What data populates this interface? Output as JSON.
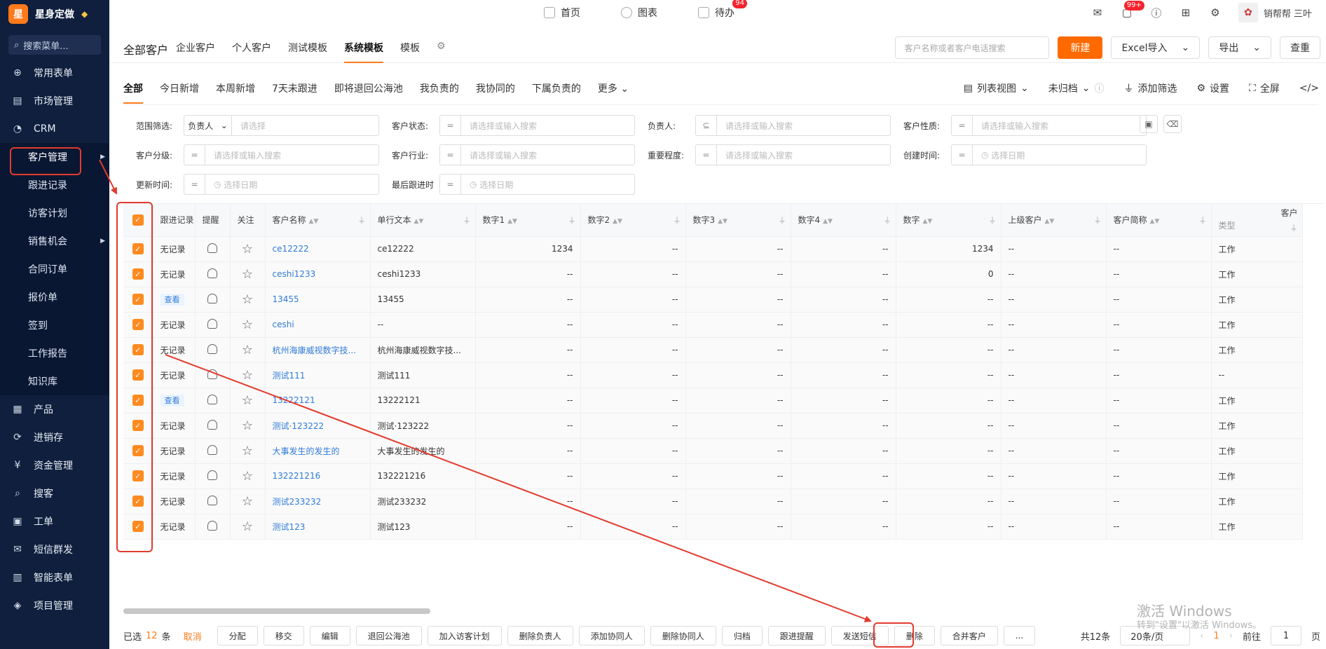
{
  "brand": {
    "logo": "星",
    "name": "星身定做"
  },
  "sidebar": {
    "search_placeholder": "搜索菜单...",
    "items": [
      {
        "label": "常用表单",
        "icon": "plus-circle-icon"
      },
      {
        "label": "市场管理",
        "icon": "clipboard-icon"
      },
      {
        "label": "CRM",
        "icon": "pie-icon"
      }
    ],
    "crm_sub": [
      {
        "label": "客户管理",
        "active": true,
        "caret": true
      },
      {
        "label": "跟进记录"
      },
      {
        "label": "访客计划"
      },
      {
        "label": "销售机会",
        "caret": true
      },
      {
        "label": "合同订单"
      },
      {
        "label": "报价单"
      },
      {
        "label": "签到"
      },
      {
        "label": "工作报告"
      },
      {
        "label": "知识库"
      }
    ],
    "items_after": [
      {
        "label": "产品",
        "icon": "blocks-icon"
      },
      {
        "label": "进销存",
        "icon": "cycle-icon"
      },
      {
        "label": "资金管理",
        "icon": "money-icon"
      },
      {
        "label": "搜客",
        "icon": "search-icon"
      },
      {
        "label": "工单",
        "icon": "ticket-icon"
      },
      {
        "label": "短信群发",
        "icon": "mail-icon"
      },
      {
        "label": "智能表单",
        "icon": "form-icon"
      },
      {
        "label": "项目管理",
        "icon": "layers-icon"
      }
    ]
  },
  "topnav": {
    "items": [
      {
        "label": "首页",
        "icon": "home-icon"
      },
      {
        "label": "图表",
        "icon": "chart-icon"
      },
      {
        "label": "待办",
        "icon": "calendar-icon",
        "badge": "94"
      }
    ],
    "msg_badge": "99+",
    "user": "销帮帮 三叶"
  },
  "page": {
    "title": "全部客户",
    "tabs": [
      "企业客户",
      "个人客户",
      "测试模板",
      "系统模板",
      "模板"
    ],
    "active_tab": "系统模板",
    "search_placeholder": "客户名称或者客户电话搜索",
    "new_label": "新建",
    "excel_label": "Excel导入",
    "export_label": "导出",
    "dedupe_label": "查重"
  },
  "filter_tabs": {
    "items": [
      "全部",
      "今日新增",
      "本周新增",
      "7天未跟进",
      "即将退回公海池",
      "我负责的",
      "我协同的",
      "下属负责的",
      "更多"
    ],
    "active": "全部",
    "view": "列表视图",
    "archive": "未归档",
    "add_filter": "添加筛选",
    "settings": "设置",
    "fullscreen": "全屏"
  },
  "filters": {
    "rows": [
      [
        {
          "label": "范围筛选:",
          "op": "负责人",
          "placeholder": "请选择"
        },
        {
          "label": "客户状态:",
          "op": "=",
          "placeholder": "请选择或输入搜索"
        },
        {
          "label": "负责人:",
          "op": "⊆",
          "placeholder": "请选择或输入搜索"
        },
        {
          "label": "客户性质:",
          "op": "=",
          "placeholder": "请选择或输入搜索"
        }
      ],
      [
        {
          "label": "客户分级:",
          "op": "=",
          "placeholder": "请选择或输入搜索"
        },
        {
          "label": "客户行业:",
          "op": "=",
          "placeholder": "请选择或输入搜索"
        },
        {
          "label": "重要程度:",
          "op": "=",
          "placeholder": "请选择或输入搜索"
        },
        {
          "label": "创建时间:",
          "op": "=",
          "placeholder": "选择日期",
          "date": true
        }
      ],
      [
        {
          "label": "更新时间:",
          "op": "=",
          "placeholder": "选择日期",
          "date": true
        },
        {
          "label": "最后跟进时",
          "op": "=",
          "placeholder": "选择日期",
          "date": true
        }
      ]
    ]
  },
  "table": {
    "columns": [
      "跟进记录",
      "提醒",
      "关注",
      "客户名称",
      "单行文本",
      "数字1",
      "数字2",
      "数字3",
      "数字4",
      "数字",
      "上级客户",
      "客户简称",
      "客户"
    ],
    "last_sub": "类型",
    "rows": [
      {
        "follow": "无记录",
        "name": "ce12222",
        "text": "ce12222",
        "n1": "1234",
        "n2": "--",
        "n3": "--",
        "n4": "--",
        "n": "1234",
        "parent": "--",
        "short": "--",
        "type": "工作"
      },
      {
        "follow": "无记录",
        "name": "ceshi1233",
        "text": "ceshi1233",
        "n1": "--",
        "n2": "--",
        "n3": "--",
        "n4": "--",
        "n": "0",
        "parent": "--",
        "short": "--",
        "type": "工作"
      },
      {
        "follow": "查看",
        "name": "13455",
        "text": "13455",
        "n1": "--",
        "n2": "--",
        "n3": "--",
        "n4": "--",
        "n": "--",
        "parent": "--",
        "short": "--",
        "type": "工作"
      },
      {
        "follow": "无记录",
        "name": "ceshi",
        "text": "--",
        "n1": "--",
        "n2": "--",
        "n3": "--",
        "n4": "--",
        "n": "--",
        "parent": "--",
        "short": "--",
        "type": "工作"
      },
      {
        "follow": "无记录",
        "name": "杭州海康威视数字技...",
        "text": "杭州海康威视数字技...",
        "n1": "--",
        "n2": "--",
        "n3": "--",
        "n4": "--",
        "n": "--",
        "parent": "--",
        "short": "--",
        "type": "工作"
      },
      {
        "follow": "无记录",
        "name": "测试111",
        "text": "测试111",
        "n1": "--",
        "n2": "--",
        "n3": "--",
        "n4": "--",
        "n": "--",
        "parent": "--",
        "short": "--",
        "type": "--"
      },
      {
        "follow": "查看",
        "name": "13222121",
        "text": "13222121",
        "n1": "--",
        "n2": "--",
        "n3": "--",
        "n4": "--",
        "n": "--",
        "parent": "--",
        "short": "--",
        "type": "工作"
      },
      {
        "follow": "无记录",
        "name": "测试·123222",
        "text": "测试·123222",
        "n1": "--",
        "n2": "--",
        "n3": "--",
        "n4": "--",
        "n": "--",
        "parent": "--",
        "short": "--",
        "type": "工作"
      },
      {
        "follow": "无记录",
        "name": "大事发生的发生的",
        "text": "大事发生的发生的",
        "n1": "--",
        "n2": "--",
        "n3": "--",
        "n4": "--",
        "n": "--",
        "parent": "--",
        "short": "--",
        "type": "工作"
      },
      {
        "follow": "无记录",
        "name": "132221216",
        "text": "132221216",
        "n1": "--",
        "n2": "--",
        "n3": "--",
        "n4": "--",
        "n": "--",
        "parent": "--",
        "short": "--",
        "type": "工作"
      },
      {
        "follow": "无记录",
        "name": "测试233232",
        "text": "测试233232",
        "n1": "--",
        "n2": "--",
        "n3": "--",
        "n4": "--",
        "n": "--",
        "parent": "--",
        "short": "--",
        "type": "工作"
      },
      {
        "follow": "无记录",
        "name": "测试123",
        "text": "测试123",
        "n1": "--",
        "n2": "--",
        "n3": "--",
        "n4": "--",
        "n": "--",
        "parent": "--",
        "short": "--",
        "type": "工作"
      }
    ]
  },
  "bottom": {
    "selected_prefix": "已选",
    "selected_count": "12",
    "selected_suffix": "条",
    "cancel": "取消",
    "actions": [
      "分配",
      "移交",
      "编辑",
      "退回公海池",
      "加入访客计划",
      "删除负责人",
      "添加协同人",
      "删除协同人",
      "归档",
      "跟进提醒",
      "发送短信",
      "删除",
      "合并客户",
      "..."
    ],
    "total": "共12条",
    "page_size": "20条/页",
    "page": "1",
    "goto": "前往",
    "goto_val": "1",
    "page_suffix": "页"
  },
  "watermark": {
    "line1": "激活 Windows",
    "line2": "转到\"设置\"以激活 Windows。"
  },
  "colors": {
    "accent": "#ff6a00",
    "sidebar": "#0f1f3d",
    "link": "#2f7bd8",
    "annotation": "#e23b2e"
  }
}
